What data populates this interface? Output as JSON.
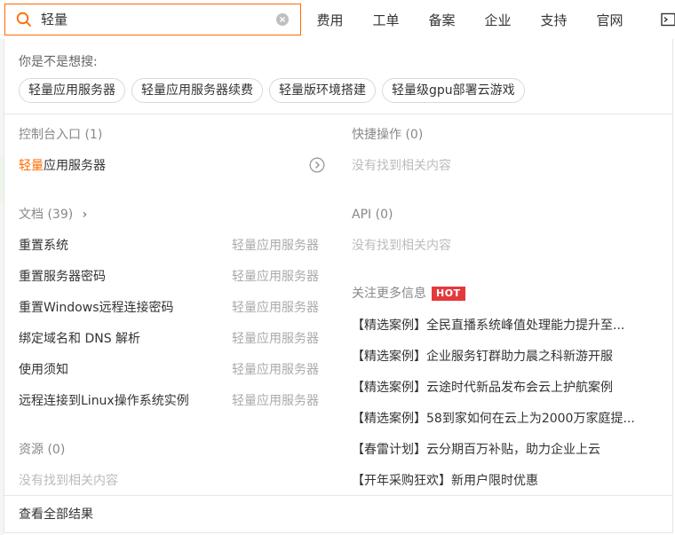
{
  "search": {
    "value": "轻量"
  },
  "nav": {
    "items": [
      "费用",
      "工单",
      "备案",
      "企业",
      "支持",
      "官网"
    ]
  },
  "suggestions": {
    "title": "你是不是想搜:",
    "chips": [
      "轻量应用服务器",
      "轻量应用服务器续费",
      "轻量版环境搭建",
      "轻量级gpu部署云游戏"
    ]
  },
  "console": {
    "title": "控制台入口",
    "count": "(1)",
    "item_highlight": "轻量",
    "item_rest": "应用服务器"
  },
  "quick_actions": {
    "title": "快捷操作",
    "count": "(0)",
    "empty": "没有找到相关内容"
  },
  "docs": {
    "title": "文档",
    "count": "(39)",
    "items": [
      {
        "title": "重置系统",
        "product": "轻量应用服务器"
      },
      {
        "title": "重置服务器密码",
        "product": "轻量应用服务器"
      },
      {
        "title": "重置Windows远程连接密码",
        "product": "轻量应用服务器"
      },
      {
        "title": "绑定域名和 DNS 解析",
        "product": "轻量应用服务器"
      },
      {
        "title": "使用须知",
        "product": "轻量应用服务器"
      },
      {
        "title": "远程连接到Linux操作系统实例",
        "product": "轻量应用服务器"
      }
    ]
  },
  "api": {
    "title": "API",
    "count": "(0)",
    "empty": "没有找到相关内容"
  },
  "more_info": {
    "title": "关注更多信息",
    "badge": "HOT",
    "items": [
      "【精选案例】全民直播系统峰值处理能力提升至...",
      "【精选案例】企业服务钉群助力晨之科新游开服",
      "【精选案例】云途时代新品发布会云上护航案例",
      "【精选案例】58到家如何在云上为2000万家庭提...",
      "【春雷计划】云分期百万补贴，助力企业上云",
      "【开年采购狂欢】新用户限时优惠"
    ]
  },
  "resources": {
    "title": "资源",
    "count": "(0)",
    "empty": "没有找到相关内容"
  },
  "footer": {
    "label": "查看全部结果"
  },
  "colors": {
    "accent": "#ff6a00",
    "hot": "#e4393c"
  }
}
